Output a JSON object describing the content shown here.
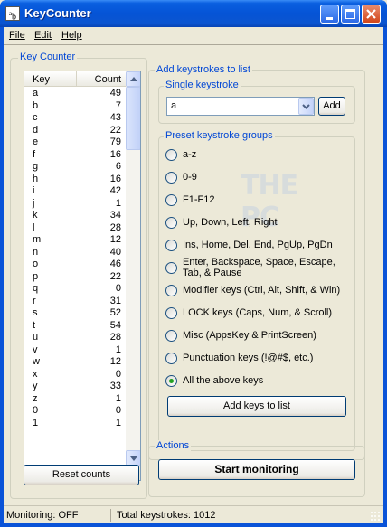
{
  "window": {
    "title": "KeyCounter"
  },
  "menu": [
    "File",
    "Edit",
    "Help"
  ],
  "key_counter": {
    "group_title": "Key Counter",
    "columns": {
      "key": "Key",
      "count": "Count"
    },
    "rows": [
      {
        "key": "a",
        "count": "49"
      },
      {
        "key": "b",
        "count": "7"
      },
      {
        "key": "c",
        "count": "43"
      },
      {
        "key": "d",
        "count": "22"
      },
      {
        "key": "e",
        "count": "79"
      },
      {
        "key": "f",
        "count": "16"
      },
      {
        "key": "g",
        "count": "6"
      },
      {
        "key": "h",
        "count": "16"
      },
      {
        "key": "i",
        "count": "42"
      },
      {
        "key": "j",
        "count": "1"
      },
      {
        "key": "k",
        "count": "34"
      },
      {
        "key": "l",
        "count": "28"
      },
      {
        "key": "m",
        "count": "12"
      },
      {
        "key": "n",
        "count": "40"
      },
      {
        "key": "o",
        "count": "46"
      },
      {
        "key": "p",
        "count": "22"
      },
      {
        "key": "q",
        "count": "0"
      },
      {
        "key": "r",
        "count": "31"
      },
      {
        "key": "s",
        "count": "52"
      },
      {
        "key": "t",
        "count": "54"
      },
      {
        "key": "u",
        "count": "28"
      },
      {
        "key": "v",
        "count": "1"
      },
      {
        "key": "w",
        "count": "12"
      },
      {
        "key": "x",
        "count": "0"
      },
      {
        "key": "y",
        "count": "33"
      },
      {
        "key": "z",
        "count": "1"
      },
      {
        "key": "0",
        "count": "0"
      },
      {
        "key": "1",
        "count": "1"
      }
    ],
    "reset_label": "Reset counts"
  },
  "add_keystrokes": {
    "group_title": "Add keystrokes to list",
    "single": {
      "title": "Single keystroke",
      "selected": "a",
      "add_label": "Add"
    },
    "preset": {
      "title": "Preset keystroke groups",
      "options": [
        {
          "label": "a-z",
          "checked": false
        },
        {
          "label": "0-9",
          "checked": false
        },
        {
          "label": "F1-F12",
          "checked": false
        },
        {
          "label": "Up, Down, Left, Right",
          "checked": false
        },
        {
          "label": "Ins, Home, Del, End, PgUp, PgDn",
          "checked": false
        },
        {
          "label": "Enter, Backspace, Space, Escape,",
          "label2": "Tab, & Pause",
          "checked": false
        },
        {
          "label": "Modifier keys (Ctrl, Alt, Shift, & Win)",
          "checked": false
        },
        {
          "label": "LOCK keys (Caps, Num, & Scroll)",
          "checked": false
        },
        {
          "label": "Misc (AppsKey & PrintScreen)",
          "checked": false
        },
        {
          "label": "Punctuation keys (!@#$, etc.)",
          "checked": false
        },
        {
          "label": "All the above keys",
          "checked": true
        }
      ],
      "add_list_label": "Add keys to list"
    }
  },
  "actions": {
    "group_title": "Actions",
    "start_label": "Start monitoring"
  },
  "status": {
    "monitoring": "Monitoring: OFF",
    "total": "Total keystrokes: 1012"
  },
  "watermark": "THE PC"
}
